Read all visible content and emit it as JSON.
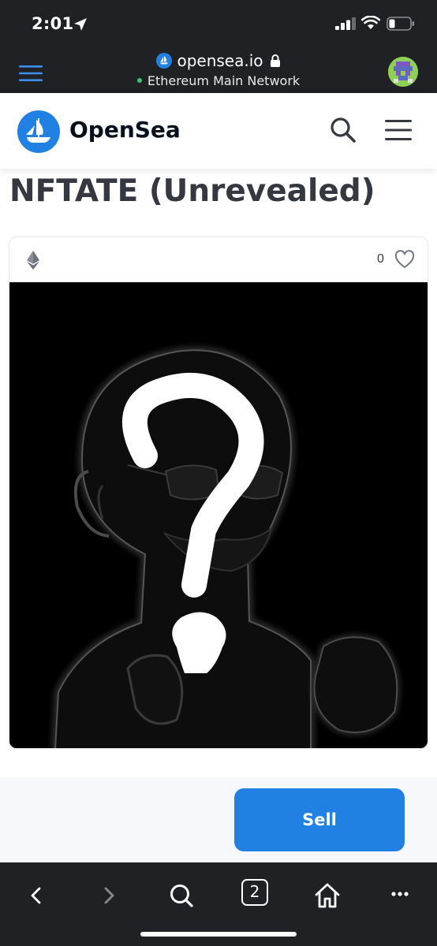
{
  "status": {
    "time": "2:01"
  },
  "browser": {
    "domain": "opensea.io",
    "network": "Ethereum Main Network",
    "open_tabs": "2"
  },
  "site": {
    "brand": "OpenSea"
  },
  "item": {
    "title": "NFTATE (Unrevealed)",
    "likes": "0",
    "chain_icon": "ethereum-icon"
  },
  "actions": {
    "sell_label": "Sell"
  },
  "colors": {
    "accent": "#2081e2",
    "chrome": "#202124",
    "title": "#353840",
    "network_dot": "#3ec37c"
  }
}
